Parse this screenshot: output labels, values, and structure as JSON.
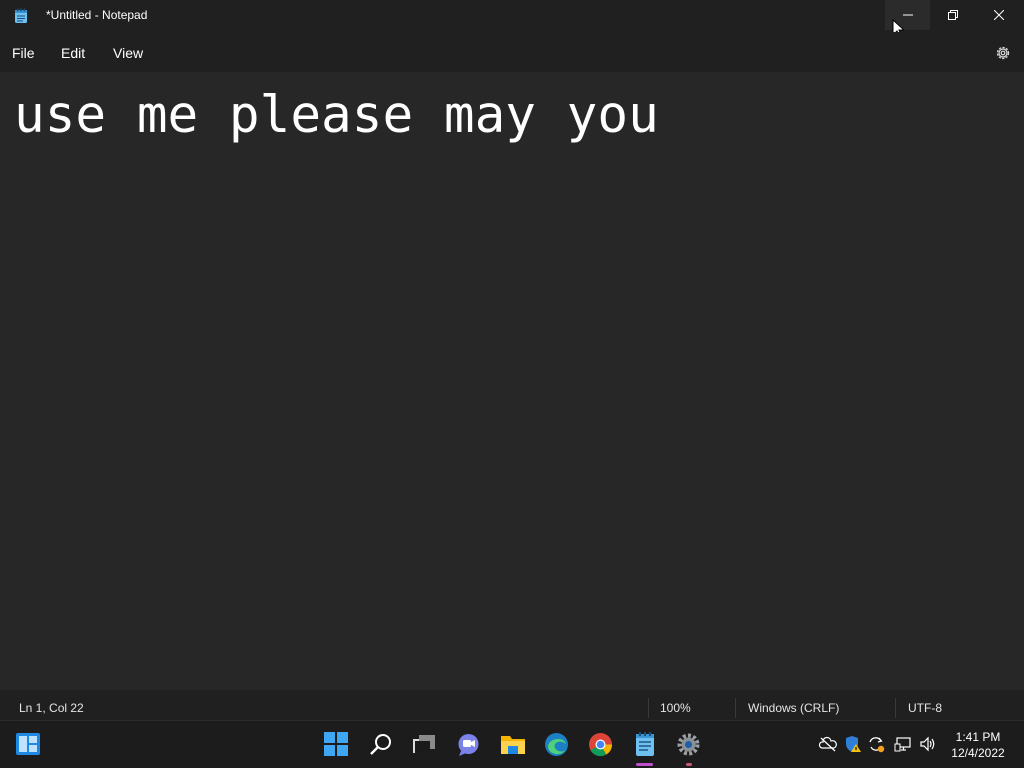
{
  "window": {
    "title": "*Untitled - Notepad",
    "app_icon": "notepad-icon"
  },
  "menu": {
    "file": "File",
    "edit": "Edit",
    "view": "View"
  },
  "editor": {
    "content": "use me please may you"
  },
  "status": {
    "position": "Ln 1, Col 22",
    "zoom": "100%",
    "line_ending": "Windows (CRLF)",
    "encoding": "UTF-8"
  },
  "taskbar": {
    "time": "1:41 PM",
    "date": "12/4/2022"
  },
  "colors": {
    "accent": "#0078d4",
    "background": "#272727",
    "chrome": "#202020"
  }
}
